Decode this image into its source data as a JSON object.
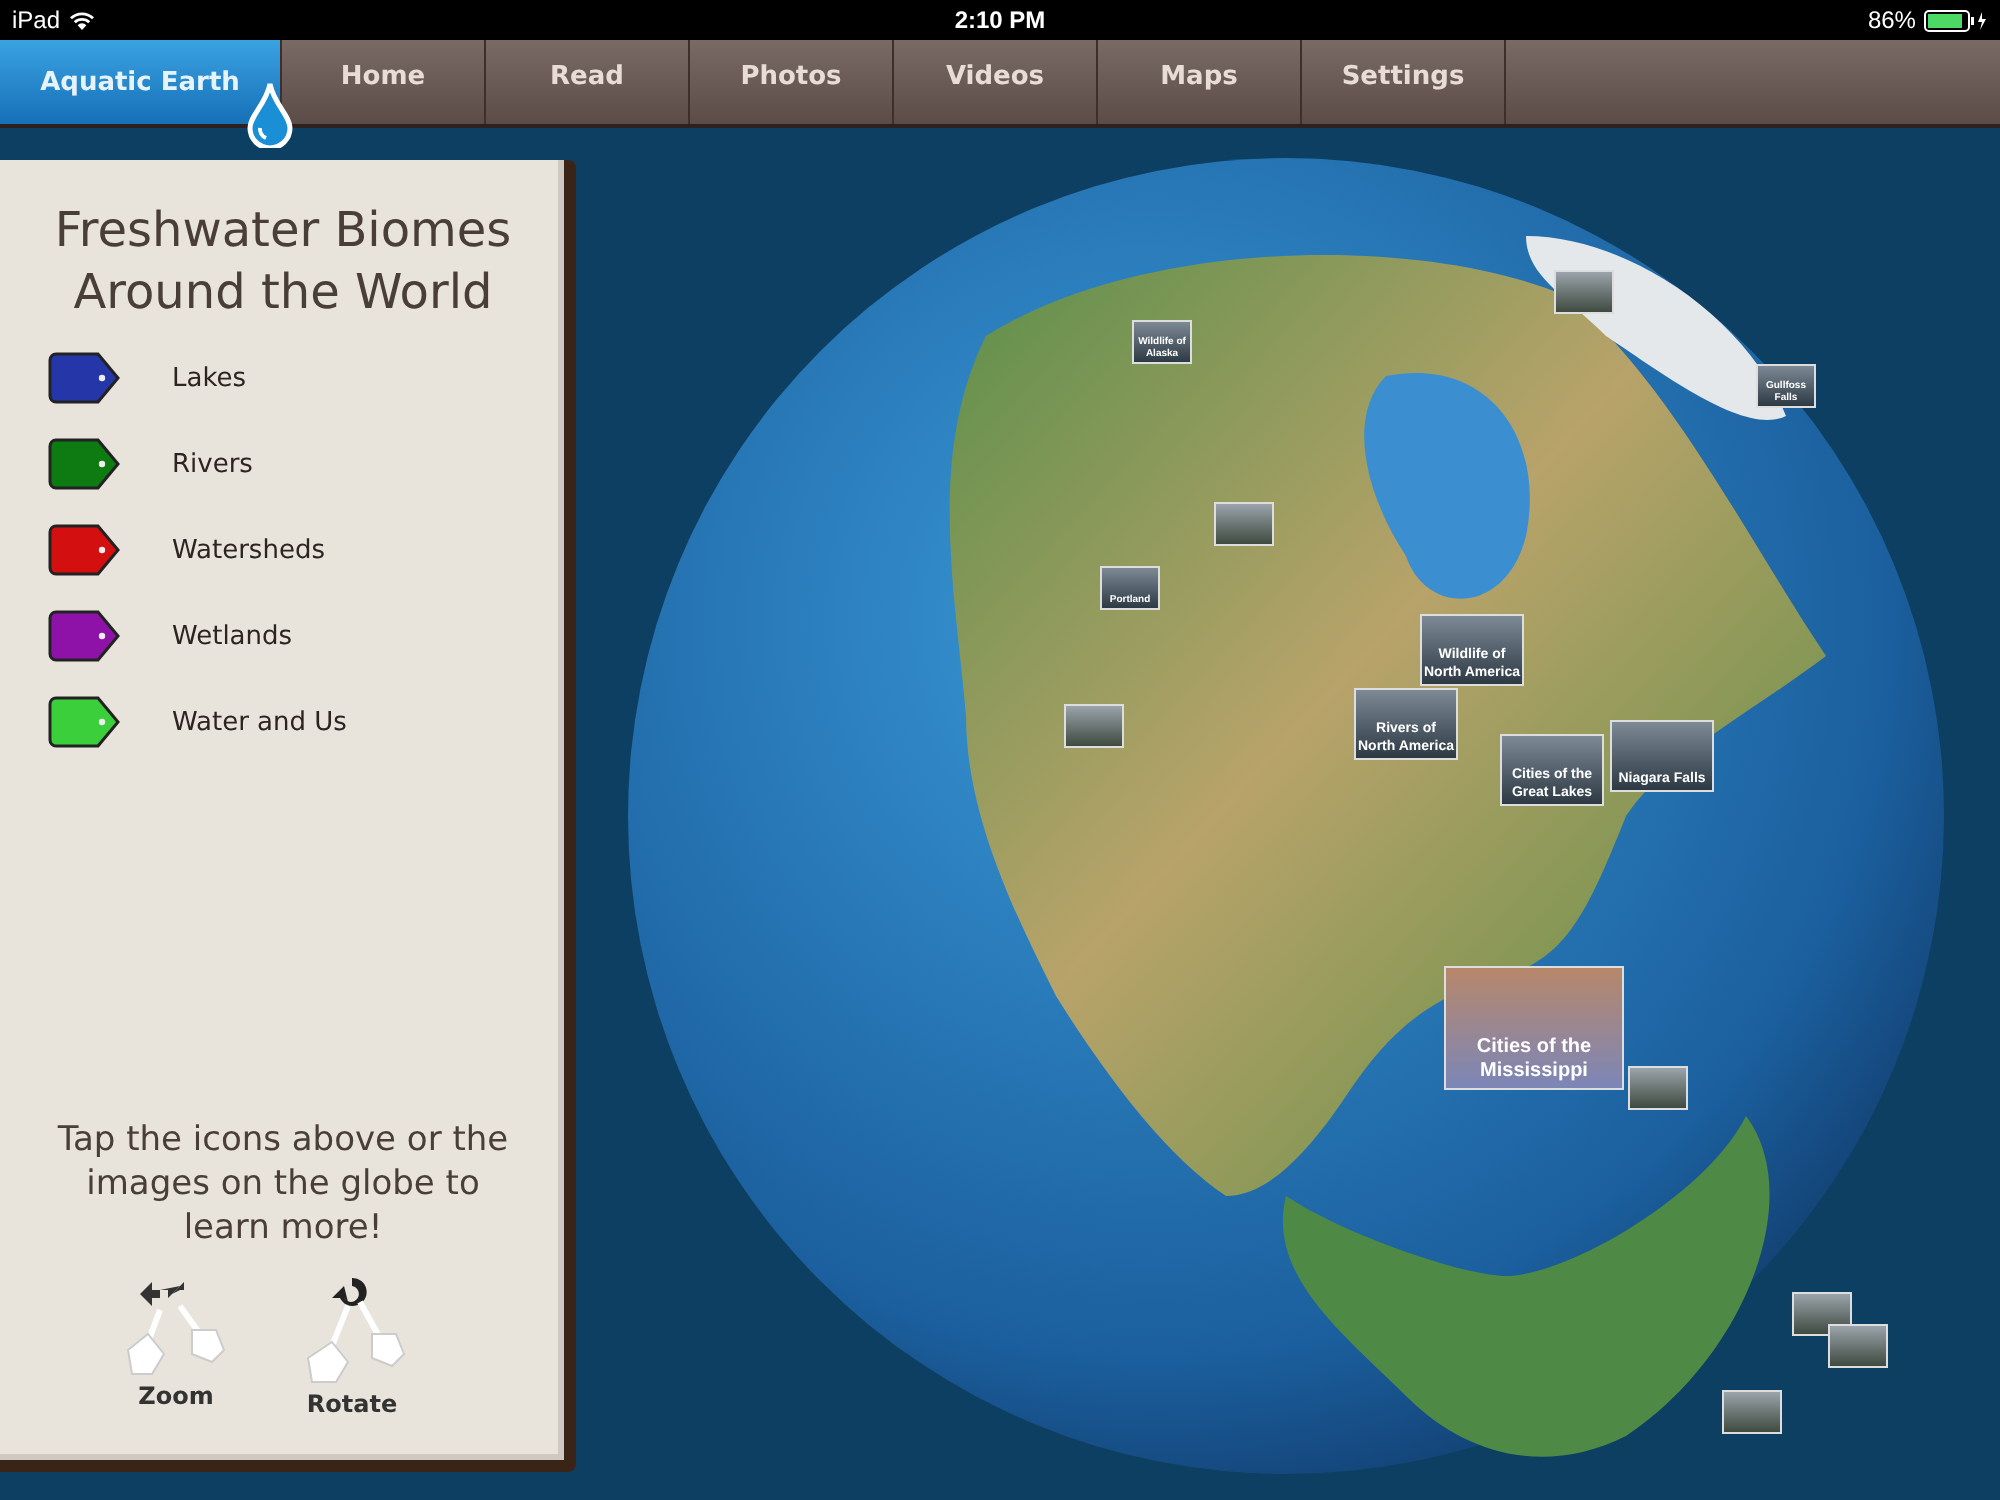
{
  "status_bar": {
    "device": "iPad",
    "time": "2:10 PM",
    "battery": "86%"
  },
  "tabs": [
    {
      "label": "Aquatic Earth",
      "selected": true
    },
    {
      "label": "Home",
      "selected": false
    },
    {
      "label": "Read",
      "selected": false
    },
    {
      "label": "Photos",
      "selected": false
    },
    {
      "label": "Videos",
      "selected": false
    },
    {
      "label": "Maps",
      "selected": false
    },
    {
      "label": "Settings",
      "selected": false
    }
  ],
  "panel": {
    "title": "Freshwater Biomes Around the World",
    "legend": [
      {
        "label": "Lakes",
        "color": "#2436a8"
      },
      {
        "label": "Rivers",
        "color": "#0e7a12"
      },
      {
        "label": "Watersheds",
        "color": "#d40f0f"
      },
      {
        "label": "Wetlands",
        "color": "#8e12a8"
      },
      {
        "label": "Water and Us",
        "color": "#3ccf3c"
      }
    ],
    "hint": "Tap the icons above or the images on the globe to learn more!",
    "gestures": [
      {
        "label": "Zoom",
        "kind": "zoom"
      },
      {
        "label": "Rotate",
        "kind": "rotate"
      }
    ]
  },
  "globe": {
    "pins": [
      {
        "label": "Wildlife of Alaska",
        "kind": "small"
      },
      {
        "label": "Gullfoss Falls",
        "kind": "small"
      },
      {
        "label": "Portland",
        "kind": "small"
      },
      {
        "label": "Wildlife of North America",
        "kind": "medium"
      },
      {
        "label": "Rivers of North America",
        "kind": "medium"
      },
      {
        "label": "Cities of the Great Lakes",
        "kind": "medium"
      },
      {
        "label": "Niagara Falls",
        "kind": "medium"
      },
      {
        "label": "Cities of the Mississippi",
        "kind": "large"
      }
    ]
  }
}
